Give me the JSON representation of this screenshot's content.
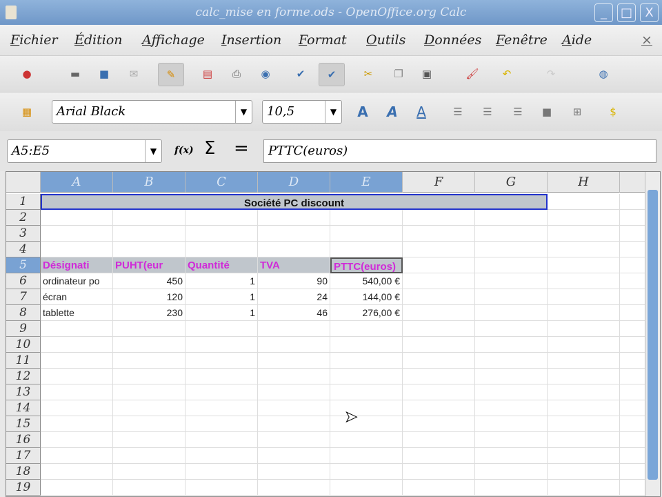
{
  "window": {
    "title": "calc_mise en forme.ods - OpenOffice.org Calc",
    "min": "_",
    "max": "□",
    "close": "X"
  },
  "menu": [
    "Fichier",
    "Édition",
    "Affichage",
    "Insertion",
    "Format",
    "Outils",
    "Données",
    "Fenêtre",
    "Aide"
  ],
  "menu_close": "×",
  "format": {
    "font": "Arial Black",
    "size": "10,5"
  },
  "formula": {
    "namebox": "A5:E5",
    "fx": "f(x)",
    "sum": "Σ",
    "eq": "=",
    "content": "PTTC(euros)"
  },
  "columns": [
    "A",
    "B",
    "C",
    "D",
    "E",
    "F",
    "G",
    "H"
  ],
  "rows": [
    "1",
    "2",
    "3",
    "4",
    "5",
    "6",
    "7",
    "8",
    "9",
    "10",
    "11",
    "12",
    "13",
    "14",
    "15",
    "16",
    "17",
    "18",
    "19"
  ],
  "sheet": {
    "title": "Société PC discount",
    "headers": [
      "Désignati",
      "PUHT(eur",
      "Quantité",
      "TVA",
      "PTTC(euros)"
    ],
    "data": [
      [
        "ordinateur po",
        "450",
        "1",
        "90",
        "540,00 €"
      ],
      [
        "écran",
        "120",
        "1",
        "24",
        "144,00 €"
      ],
      [
        "tablette",
        "230",
        "1",
        "46",
        "276,00 €"
      ]
    ]
  }
}
